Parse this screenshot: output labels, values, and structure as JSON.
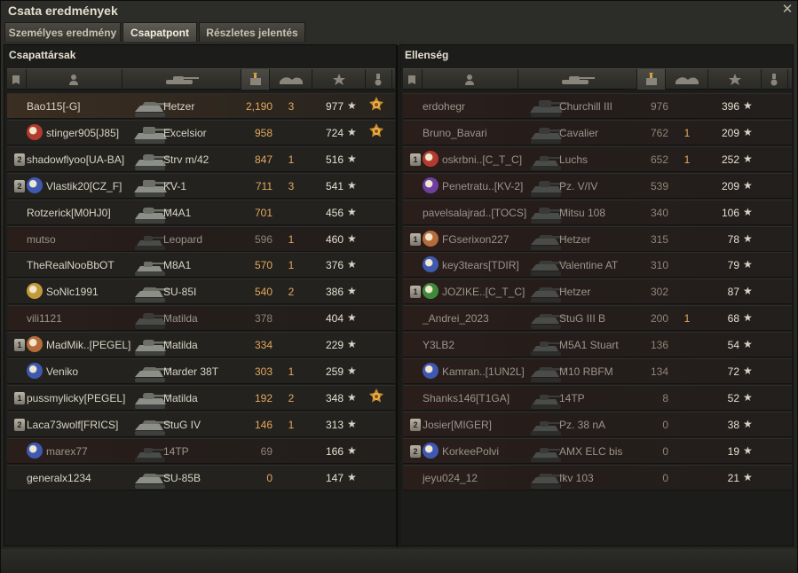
{
  "window": {
    "title": "Csata eredmények",
    "close_icon": "close-icon"
  },
  "tabs": [
    {
      "label": "Személyes eredmény",
      "active": false
    },
    {
      "label": "Csapatpont",
      "active": true
    },
    {
      "label": "Részletes jelentés",
      "active": false
    }
  ],
  "columns": [
    "badge-icon",
    "player-icon",
    "tank-icon",
    "damage-icon",
    "kills-icon",
    "xp-star-icon",
    "medal-icon"
  ],
  "sorted_column": "damage",
  "colors": {
    "accent": "#e4a85e",
    "dead_row": "#2a1e1b",
    "own_row": "#3b2e22"
  },
  "allies": {
    "title": "Csapattársak",
    "rows": [
      {
        "badge": "",
        "clan": "",
        "name": "Bao115[-G]",
        "vehicle": "Hetzer",
        "damage": "2,190",
        "kills": "3",
        "xp": "977",
        "medal": true,
        "dead": false,
        "me": true,
        "tank": "td"
      },
      {
        "badge": "",
        "clan": "#b33a2e",
        "name": "stinger905[J85]",
        "vehicle": "Excelsior",
        "damage": "958",
        "kills": "",
        "xp": "724",
        "medal": true,
        "dead": false,
        "me": false,
        "tank": "heavy"
      },
      {
        "badge": "2",
        "clan": "",
        "name": "shadowflyoo[UA-BA]",
        "vehicle": "Strv m/42",
        "damage": "847",
        "kills": "1",
        "xp": "516",
        "medal": false,
        "dead": false,
        "me": false,
        "tank": "medium"
      },
      {
        "badge": "2",
        "clan": "#3f59b0",
        "name": "Vlastik20[CZ_F]",
        "vehicle": "KV-1",
        "damage": "711",
        "kills": "3",
        "xp": "541",
        "medal": false,
        "dead": false,
        "me": false,
        "tank": "heavy"
      },
      {
        "badge": "",
        "clan": "",
        "name": "Rotzerick[M0HJ0]",
        "vehicle": "M4A1",
        "damage": "701",
        "kills": "",
        "xp": "456",
        "medal": false,
        "dead": false,
        "me": false,
        "tank": "medium"
      },
      {
        "badge": "",
        "clan": "",
        "name": "mutso",
        "vehicle": "Leopard",
        "damage": "596",
        "kills": "1",
        "xp": "460",
        "medal": false,
        "dead": true,
        "me": false,
        "tank": "light"
      },
      {
        "badge": "",
        "clan": "",
        "name": "TheRealNooBbOT",
        "vehicle": "M8A1",
        "damage": "570",
        "kills": "1",
        "xp": "376",
        "medal": false,
        "dead": false,
        "me": false,
        "tank": "light"
      },
      {
        "badge": "",
        "clan": "#c19a3a",
        "name": "SoNlc1991",
        "vehicle": "SU-85I",
        "damage": "540",
        "kills": "2",
        "xp": "386",
        "medal": false,
        "dead": false,
        "me": false,
        "tank": "td"
      },
      {
        "badge": "",
        "clan": "",
        "name": "vili1121",
        "vehicle": "Matilda",
        "damage": "378",
        "kills": "",
        "xp": "404",
        "medal": false,
        "dead": true,
        "me": false,
        "tank": "medium"
      },
      {
        "badge": "1",
        "clan": "#b66c3a",
        "name": "MadMik..[PEGEL]",
        "vehicle": "Matilda",
        "damage": "334",
        "kills": "",
        "xp": "229",
        "medal": false,
        "dead": false,
        "me": false,
        "tank": "medium"
      },
      {
        "badge": "",
        "clan": "#3f59b0",
        "name": "Veniko",
        "vehicle": "Marder 38T",
        "damage": "303",
        "kills": "1",
        "xp": "259",
        "medal": false,
        "dead": false,
        "me": false,
        "tank": "td"
      },
      {
        "badge": "1",
        "clan": "",
        "name": "pussmylicky[PEGEL]",
        "vehicle": "Matilda",
        "damage": "192",
        "kills": "2",
        "xp": "348",
        "medal": true,
        "dead": false,
        "me": false,
        "tank": "medium"
      },
      {
        "badge": "2",
        "clan": "",
        "name": "Laca73wolf[FRICS]",
        "vehicle": "StuG IV",
        "damage": "146",
        "kills": "1",
        "xp": "313",
        "medal": false,
        "dead": false,
        "me": false,
        "tank": "td"
      },
      {
        "badge": "",
        "clan": "#3f59b0",
        "name": "marex77",
        "vehicle": "14TP",
        "damage": "69",
        "kills": "",
        "xp": "166",
        "medal": false,
        "dead": true,
        "me": false,
        "tank": "light"
      },
      {
        "badge": "",
        "clan": "",
        "name": "generalx1234",
        "vehicle": "SU-85B",
        "damage": "0",
        "kills": "",
        "xp": "147",
        "medal": false,
        "dead": false,
        "me": false,
        "tank": "td"
      }
    ]
  },
  "enemies": {
    "title": "Ellenség",
    "rows": [
      {
        "badge": "",
        "clan": "",
        "name": "erdohegr",
        "vehicle": "Churchill III",
        "damage": "976",
        "kills": "",
        "xp": "396",
        "medal": false,
        "dead": true,
        "me": false,
        "tank": "heavy"
      },
      {
        "badge": "",
        "clan": "",
        "name": "Bruno_Bavari",
        "vehicle": "Cavalier",
        "damage": "762",
        "kills": "1",
        "xp": "209",
        "medal": false,
        "dead": true,
        "me": false,
        "tank": "medium"
      },
      {
        "badge": "1",
        "clan": "#b33a2e",
        "name": "oskrbni..[C_T_C]",
        "vehicle": "Luchs",
        "damage": "652",
        "kills": "1",
        "xp": "252",
        "medal": false,
        "dead": true,
        "me": false,
        "tank": "light"
      },
      {
        "badge": "",
        "clan": "#6c3fa0",
        "name": "Penetratu..[KV-2]",
        "vehicle": "Pz. V/IV",
        "damage": "539",
        "kills": "",
        "xp": "209",
        "medal": false,
        "dead": true,
        "me": false,
        "tank": "medium"
      },
      {
        "badge": "",
        "clan": "",
        "name": "pavelsalajrad..[TOCS]",
        "vehicle": "Mitsu 108",
        "damage": "340",
        "kills": "",
        "xp": "106",
        "medal": false,
        "dead": true,
        "me": false,
        "tank": "medium"
      },
      {
        "badge": "1",
        "clan": "#b66c3a",
        "name": "FGserixon227",
        "vehicle": "Hetzer",
        "damage": "315",
        "kills": "",
        "xp": "78",
        "medal": false,
        "dead": true,
        "me": false,
        "tank": "td"
      },
      {
        "badge": "",
        "clan": "#3f59b0",
        "name": "key3tears[TDIR]",
        "vehicle": "Valentine AT",
        "damage": "310",
        "kills": "",
        "xp": "79",
        "medal": false,
        "dead": true,
        "me": false,
        "tank": "td"
      },
      {
        "badge": "1",
        "clan": "#3e8a3a",
        "name": "JOZIKE..[C_T_C]",
        "vehicle": "Hetzer",
        "damage": "302",
        "kills": "",
        "xp": "87",
        "medal": false,
        "dead": true,
        "me": false,
        "tank": "td"
      },
      {
        "badge": "",
        "clan": "",
        "name": "_Andrei_2023",
        "vehicle": "StuG III B",
        "damage": "200",
        "kills": "1",
        "xp": "68",
        "medal": false,
        "dead": true,
        "me": false,
        "tank": "td"
      },
      {
        "badge": "",
        "clan": "",
        "name": "Y3LB2",
        "vehicle": "M5A1 Stuart",
        "damage": "136",
        "kills": "",
        "xp": "54",
        "medal": false,
        "dead": true,
        "me": false,
        "tank": "light"
      },
      {
        "badge": "",
        "clan": "#3f59b0",
        "name": "Kamran..[1UN2L]",
        "vehicle": "M10 RBFM",
        "damage": "134",
        "kills": "",
        "xp": "72",
        "medal": false,
        "dead": true,
        "me": false,
        "tank": "td"
      },
      {
        "badge": "",
        "clan": "",
        "name": "Shanks146[T1GA]",
        "vehicle": "14TP",
        "damage": "8",
        "kills": "",
        "xp": "52",
        "medal": false,
        "dead": true,
        "me": false,
        "tank": "light"
      },
      {
        "badge": "2",
        "clan": "",
        "name": "Josier[MIGER]",
        "vehicle": "Pz. 38 nA",
        "damage": "0",
        "kills": "",
        "xp": "38",
        "medal": false,
        "dead": true,
        "me": false,
        "tank": "light"
      },
      {
        "badge": "2",
        "clan": "#3f59b0",
        "name": "KorkeePolvi",
        "vehicle": "AMX ELC bis",
        "damage": "0",
        "kills": "",
        "xp": "19",
        "medal": false,
        "dead": true,
        "me": false,
        "tank": "light"
      },
      {
        "badge": "",
        "clan": "",
        "name": "jeyu024_12",
        "vehicle": "Ikv 103",
        "damage": "0",
        "kills": "",
        "xp": "21",
        "medal": false,
        "dead": true,
        "me": false,
        "tank": "td"
      }
    ]
  },
  "star_glyph": "★"
}
